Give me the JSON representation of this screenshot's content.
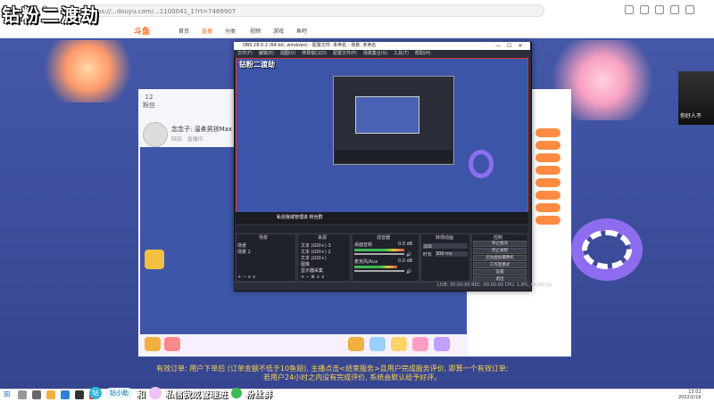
{
  "overlay": {
    "title": "钻粉二渡劫",
    "preview_title": "钻粉二渡劫"
  },
  "browser": {
    "url": "https://...douyu.com/...1100041_1?rt=7469907",
    "back": "←",
    "forward": "→",
    "reload": "⟳"
  },
  "site": {
    "logo": "斗鱼",
    "nav": [
      "首页",
      "直播",
      "分类",
      "视频",
      "游戏",
      "鱼吧"
    ],
    "stats": [
      {
        "value": "12",
        "label": "粉丝"
      },
      {
        "value": "",
        "label": ""
      },
      {
        "value": "",
        "label": ""
      }
    ],
    "streamer_name": "念念子: 温柔男孩Max",
    "streamer_sub": "陪玩 · 直播中",
    "portrait_text": "你好人不"
  },
  "obs": {
    "window_title": "OBS 28.0.2 (64-bit, windows) - 配置文件: 未命名 - 场景: 未命名",
    "menu": [
      "文件(F)",
      "编辑(E)",
      "视图(V)",
      "停靠窗口(D)",
      "配置文件(P)",
      "场景集合(S)",
      "工具(T)",
      "帮助(H)"
    ],
    "preview_label": "私信我或管理进 粉丝群",
    "docks": {
      "scenes": {
        "title": "场景",
        "items": [
          "场景",
          "场景 2"
        ]
      },
      "sources": {
        "title": "来源",
        "items": [
          "文本 (GDI+) 3",
          "文本 (GDI+) 2",
          "文本 (GDI+)",
          "图像",
          "显示器采集"
        ]
      },
      "mixer": {
        "title": "混音器",
        "channels": [
          {
            "name": "桌面音频",
            "db": "0.0 dB"
          },
          {
            "name": "麦克风/Aux",
            "db": "0.0 dB"
          }
        ]
      },
      "transitions": {
        "title": "转场动画",
        "type": "淡出",
        "duration_label": "时长",
        "duration": "300 ms"
      },
      "controls": {
        "title": "控制",
        "buttons": [
          "停止推流",
          "停止录制",
          "启动虚拟摄像机",
          "工作室模式",
          "设置",
          "退出"
        ]
      }
    },
    "status": "LIVE: 00:00:00  REC: 00:00:00  CPU: 1.8%, 60.00 fps"
  },
  "notice": {
    "line1": "有效订单: 用户下单后 (订单金额不低于10鱼翅), 主播点击<结束服务>且用户完成服务评价, 即算一个有效订单;",
    "line2": "若用户24小时之内没有完成评价, 系统会默认给予好评。"
  },
  "promo": {
    "badge": "钻",
    "pill": "钻小助",
    "and": "和",
    "text": "私信我或管理进",
    "group": "粉丝群"
  },
  "taskbar": {
    "time": "13:02",
    "date": "2022/2/16"
  },
  "colors": {
    "accent": "#ff6a1f",
    "obs_bg": "#2b2e38",
    "notice": "#ffd34d",
    "ring": "#8e6cf0"
  }
}
